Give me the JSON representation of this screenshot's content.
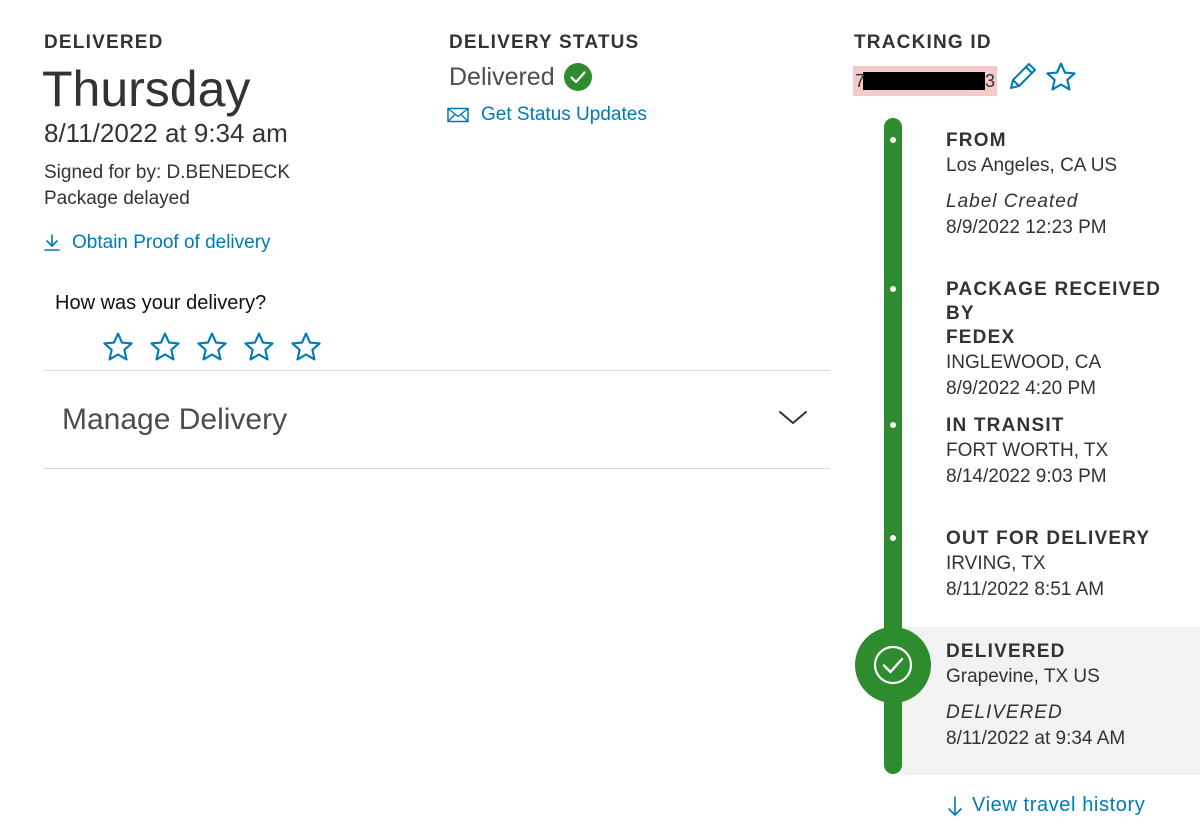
{
  "delivery": {
    "label": "DELIVERED",
    "day": "Thursday",
    "datetime": "8/11/2022 at 9:34 am",
    "signed_for": "Signed for by: D.BENEDECK",
    "note": "Package delayed",
    "proof_link": "Obtain Proof of delivery"
  },
  "rating": {
    "question": "How was your delivery?",
    "stars": 5
  },
  "manage": {
    "label": "Manage Delivery"
  },
  "status": {
    "label": "DELIVERY STATUS",
    "value": "Delivered",
    "updates_link": "Get Status Updates"
  },
  "tracking": {
    "label": "TRACKING ID",
    "number_first": "7",
    "number_last": "3"
  },
  "timeline": {
    "events": [
      {
        "title": "FROM",
        "location": "Los Angeles, CA US",
        "status": "Label Created",
        "datetime": "8/9/2022 12:23 PM"
      },
      {
        "title_line1": "PACKAGE RECEIVED BY",
        "title_line2": "FEDEX",
        "location": "INGLEWOOD, CA",
        "datetime": "8/9/2022 4:20 PM"
      },
      {
        "title": "IN TRANSIT",
        "location": "FORT WORTH, TX",
        "datetime": "8/14/2022 9:03 PM"
      },
      {
        "title": "OUT FOR DELIVERY",
        "location": "IRVING, TX",
        "datetime": "8/11/2022 8:51 AM"
      },
      {
        "title": "DELIVERED",
        "location": "Grapevine, TX US",
        "status": "DELIVERED",
        "datetime": "8/11/2022 at 9:34 AM"
      }
    ],
    "history_link": "View travel history"
  },
  "colors": {
    "accent_green": "#2e8b2e",
    "link_blue": "#007ab7",
    "text": "#333333",
    "redaction_bg": "#f3c9c9"
  },
  "icons": {
    "status": "check-circle-icon",
    "updates": "envelope-icon",
    "proof": "download-icon",
    "edit": "pencil-icon",
    "favorite": "star-outline-icon",
    "manage": "chevron-down-icon",
    "history": "arrow-down-icon"
  }
}
